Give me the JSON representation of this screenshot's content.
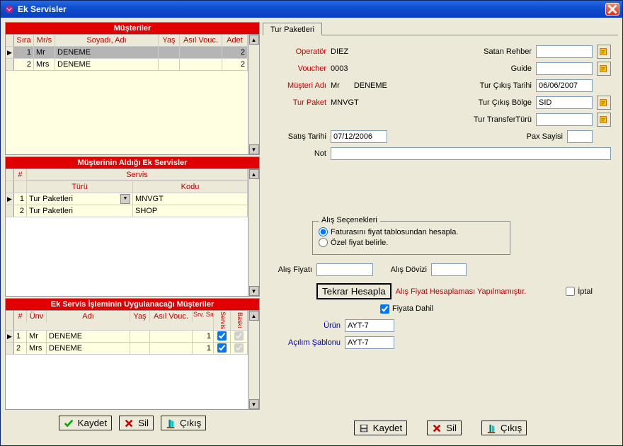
{
  "window": {
    "title": "Ek Servisler"
  },
  "left": {
    "customers": {
      "header": "Müşteriler",
      "cols": {
        "sira": "Sıra",
        "mrs": "Mr/s",
        "name": "Soyadı, Adı",
        "yas": "Yaş",
        "asil": "Asıl Vouc.",
        "adet": "Adet"
      },
      "rows": [
        {
          "sira": "1",
          "mrs": "Mr",
          "name": "DENEME",
          "yas": "",
          "asil": "",
          "adet": "2"
        },
        {
          "sira": "2",
          "mrs": "Mrs",
          "name": "DENEME",
          "yas": "",
          "asil": "",
          "adet": "2"
        }
      ]
    },
    "services": {
      "header": "Müşterinin Aldığı Ek Servisler",
      "cols": {
        "num": "#",
        "servis": "Servis",
        "turu": "Türü",
        "kodu": "Kodu"
      },
      "rows": [
        {
          "num": "1",
          "turu": "Tur Paketleri",
          "kodu": "MNVGT"
        },
        {
          "num": "2",
          "turu": "Tur Paketleri",
          "kodu": "SHOP"
        }
      ]
    },
    "apply": {
      "header": "Ek Servis İşleminin Uygulanacağı Müşteriler",
      "cols": {
        "num": "#",
        "unv": "Ünv",
        "adi": "Adı",
        "yas": "Yaş",
        "asil": "Asıl Vouc.",
        "srv": "Srv. Sıra",
        "servis": "Servis",
        "baski": "Baskı"
      },
      "rows": [
        {
          "num": "1",
          "unv": "Mr",
          "adi": "DENEME",
          "yas": "",
          "asil": "",
          "srv": "1",
          "servis": true,
          "baski": true
        },
        {
          "num": "2",
          "unv": "Mrs",
          "adi": "DENEME",
          "yas": "",
          "asil": "",
          "srv": "1",
          "servis": true,
          "baski": true
        }
      ]
    },
    "buttons": {
      "kaydet": "Kaydet",
      "sil": "Sil",
      "cikis": "Çıkış"
    }
  },
  "right": {
    "tab": "Tur Paketleri",
    "labels": {
      "operator": "Operatör",
      "voucher": "Voucher",
      "musteri": "Müşteri Adı",
      "turpaket": "Tur Paket",
      "satan": "Satan Rehber",
      "guide": "Guide",
      "turciktar": "Tur Çıkış Tarihi",
      "turcikbol": "Tur Çıkış Bölge",
      "turtransfer": "Tur TransferTürü",
      "satis": "Satış Tarihi",
      "pax": "Pax Sayisi",
      "not": "Not",
      "alisgroup": "Alış Seçenekleri",
      "radio1": "Faturasını fiyat tablosundan hesapla.",
      "radio2": "Özel fiyat belirle.",
      "alisfiyat": "Alış Fiyatı",
      "alisdoviz": "Alış Dövizi",
      "tekrar": "Tekrar Hesapla",
      "status": "Alış Fiyat Hesaplaması Yapılmamıştır.",
      "iptal": "İptal",
      "fiyatadahil": "Fiyata Dahil",
      "urun": "Ürün",
      "acilim": "Açılım Şablonu"
    },
    "values": {
      "operator": "DIEZ",
      "voucher": "0003",
      "musteri_pre": "Mr",
      "musteri": "DENEME",
      "turpaket": "MNVGT",
      "turciktar": "06/06/2007",
      "turcikbol": "SID",
      "satis": "07/12/2006",
      "urun": "AYT-7",
      "acilim": "AYT-7"
    },
    "buttons": {
      "kaydet": "Kaydet",
      "sil": "Sil",
      "cikis": "Çıkış"
    }
  }
}
